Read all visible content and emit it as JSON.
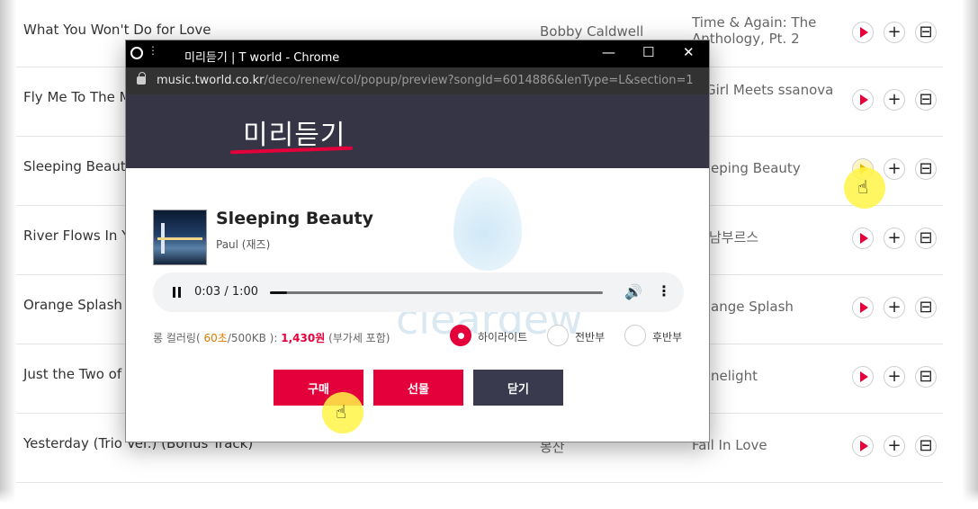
{
  "song_list": [
    {
      "title": "What You Won't Do for Love",
      "artist": "Bobby Caldwell",
      "album": "Time & Again: The Anthology, Pt. 2"
    },
    {
      "title": "Fly Me To The M",
      "artist": "",
      "album": "Girl Meets ssanova"
    },
    {
      "title": "Sleeping Beauty",
      "artist": "",
      "album": "eping Beauty"
    },
    {
      "title": "River Flows In Y",
      "artist": "",
      "album": "남부르스"
    },
    {
      "title": "Orange Splash",
      "artist": "",
      "album": "ange Splash"
    },
    {
      "title": "Just the Two of",
      "artist": "",
      "album": "nelight"
    },
    {
      "title": "Yesterday (Trio Ver.) (Bonus Track)",
      "artist": "봉산",
      "album": "Fall In Love"
    }
  ],
  "popup": {
    "window_title": "미리듣기 | T world - Chrome",
    "url_host": "music.tworld.co.kr",
    "url_path": "/deco/renew/col/popup/preview?songId=6014886&lenType=L&section=1",
    "header_title": "미리듣기",
    "song_name": "Sleeping Beauty",
    "song_artist": "Paul (재즈)",
    "player_time": "0:03 / 1:00",
    "player_progress": 0.05,
    "price_prefix": "롱 컬러링(",
    "price_seconds": "60초",
    "price_size": "/500KB ):",
    "price_amount": "1,430원",
    "price_suffix": "(부가세 포함)",
    "options": [
      "하이라이트",
      "전반부",
      "후반부"
    ],
    "selected_option": "하이라이트",
    "buttons": {
      "buy": "구매",
      "gift": "선물",
      "close": "닫기"
    },
    "watermark": "cleardew"
  },
  "colors": {
    "accent": "#e4003a",
    "header_bg": "#353545",
    "close_btn": "#3a3a4e"
  },
  "icons": [
    "play-icon",
    "add-icon",
    "gift-icon",
    "pause-icon",
    "volume-icon",
    "more-icon",
    "lock-icon",
    "globe-icon"
  ]
}
